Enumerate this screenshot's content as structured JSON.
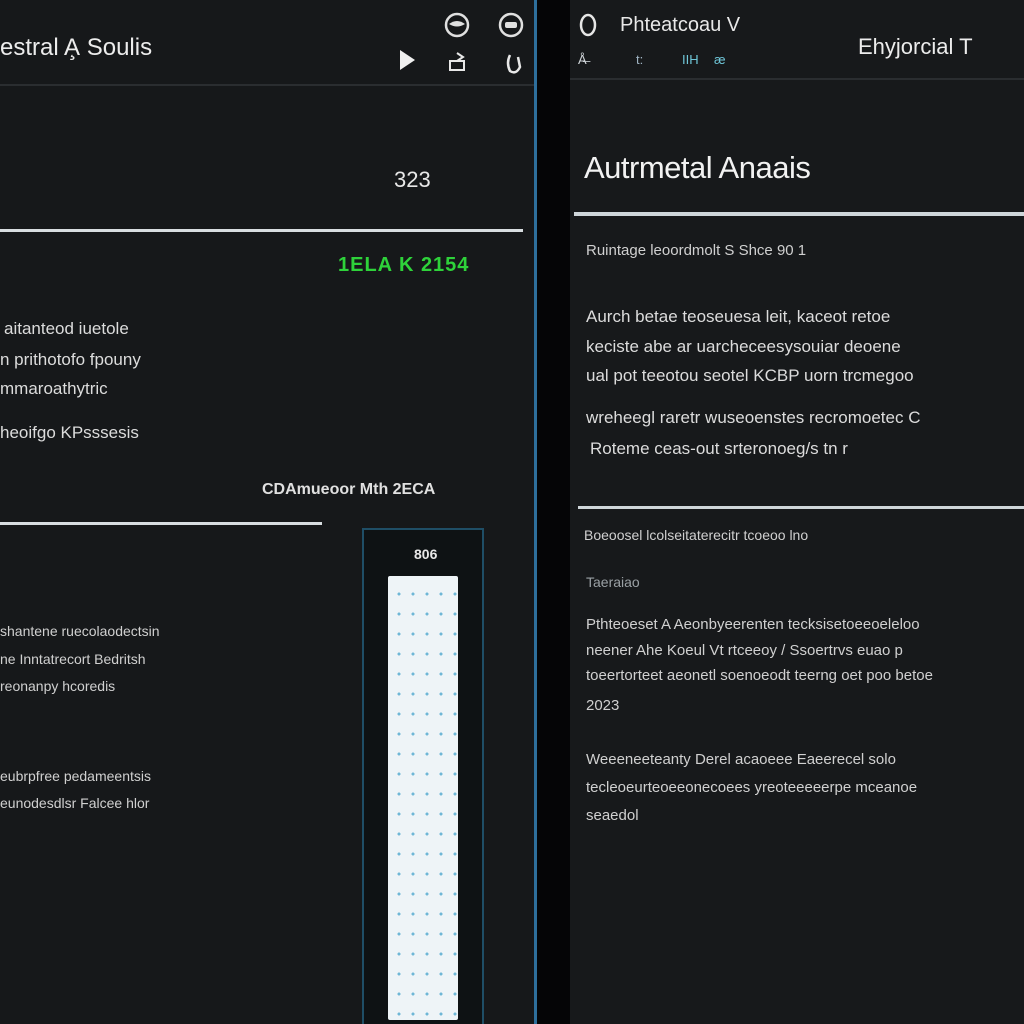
{
  "left": {
    "title": "estral A̧ Soulis",
    "value_top": "323",
    "green_label": "1ELA K 2154",
    "text_lines_a": [
      "aitanteod iuetole",
      "n prithotofo fpouny",
      "mmaroathytric",
      "heoifgo KPsssesis"
    ],
    "caption_row": "CDAmueoor Mth 2ECA",
    "scroll_value": "806",
    "text_lines_b": [
      "shantene ruecolaodectsin",
      "ne Inntatrecort Bedritsh",
      "reonanpy hcoredis"
    ],
    "text_lines_c": [
      "eubrpfree pedameentsis",
      "eunodesdlsr Falcee hlor"
    ]
  },
  "right": {
    "window_title": "Phteatcoau V",
    "tab_labels": [
      "Å̶",
      "t:",
      "IIH",
      "æ"
    ],
    "side_title": "Ehyjorcial T",
    "heading": "Autrmetal Anaais",
    "subheading": "Ruintage leoordmolt S Shce 90 1",
    "para1": [
      "Aurch betae teoseuesa leit, kaceot retoe",
      "keciste abe ar uarcheceesysouiar deoene",
      "ual pot teeotou seotel KCBP uorn trcmegoo"
    ],
    "para2": [
      "wreheegl raretr wuseoenstes recromoetec C",
      "Roteme ceas-out srteronoeg/s tn r"
    ],
    "section2_title": "Boeoosel lcolseitaterecitr tcoeoo lno",
    "section2_sub": "Taeraiao",
    "para3": [
      "Pthteoeset A Aeonbyeerenten tecksisetoeeoeleloo",
      "neener Ahe Koeul Vt  rtceeoy / Ssoertrvs euao p",
      "toeertorteet aeonetl soenoeodt teerng oet poo betoe"
    ],
    "para3_tail": "2023",
    "para4": [
      "Weeeneeteanty Derel acaoeee Eaeerecel solo",
      "tecleoeurteoeeonecoees yreoteeeeerpe mceanoe",
      "seaedol"
    ]
  },
  "colors": {
    "accent_blue": "#2e6f9c",
    "green": "#2ed23a"
  },
  "icons": {
    "left_top": [
      "globe-icon",
      "settings-icon"
    ],
    "left_toolbar": [
      "play-icon",
      "export-icon",
      "attach-icon"
    ],
    "right": [
      "circle-icon"
    ]
  }
}
